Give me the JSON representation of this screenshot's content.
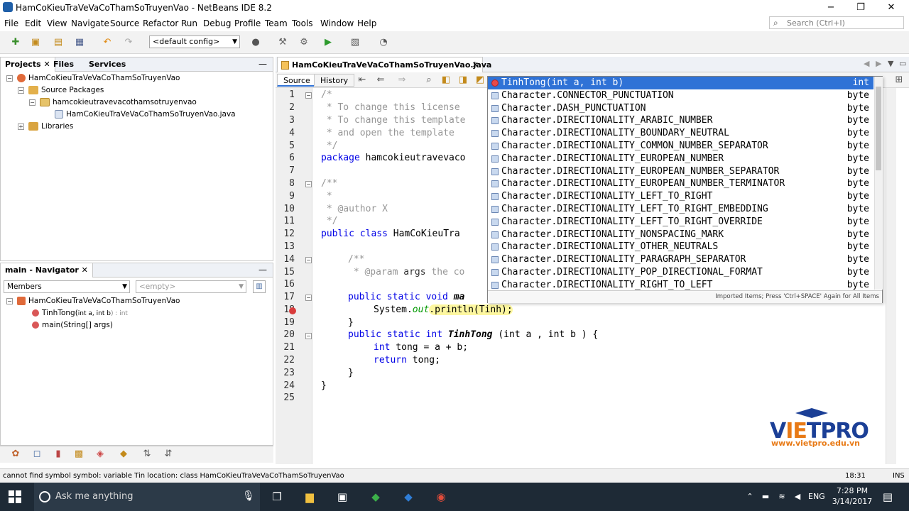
{
  "window": {
    "title": "HamCoKieuTraVeVaCoThamSoTruyenVao - NetBeans IDE 8.2",
    "minimize": "−",
    "restore": "❐",
    "close": "✕"
  },
  "menu": [
    "File",
    "Edit",
    "View",
    "Navigate",
    "Source",
    "Refactor",
    "Run",
    "Debug",
    "Profile",
    "Team",
    "Tools",
    "Window",
    "Help"
  ],
  "search": {
    "placeholder": "Search (Ctrl+I)"
  },
  "toolbar": {
    "config": "<default config>"
  },
  "projects_panel": {
    "tabs": [
      "Projects",
      "Files",
      "Services"
    ],
    "tree": [
      {
        "label": "HamCoKieuTraVeVaCoThamSoTruyenVao",
        "level": 0,
        "icon": "project-icon"
      },
      {
        "label": "Source Packages",
        "level": 1,
        "icon": "folder-icon"
      },
      {
        "label": "hamcokieutravevacothamsotruyenvao",
        "level": 2,
        "icon": "package-icon"
      },
      {
        "label": "HamCoKieuTraVeVaCoThamSoTruyenVao.java",
        "level": 3,
        "icon": "java-file-icon"
      },
      {
        "label": "Libraries",
        "level": 1,
        "icon": "library-icon"
      }
    ]
  },
  "navigator_panel": {
    "title": "main - Navigator",
    "members_combo": "Members",
    "empty_combo": "<empty>",
    "root": "HamCoKieuTraVeVaCoThamSoTruyenVao",
    "items": [
      {
        "name": "TinhTong(",
        "params": "int a, int b",
        "ret": ") : int"
      },
      {
        "name": "main(String[] args)",
        "params": "",
        "ret": ""
      }
    ]
  },
  "editor": {
    "file_tab": "HamCoKieuTraVeVaCoThamSoTruyenVao.java",
    "source_tab": "Source",
    "history_tab": "History",
    "line_numbers": [
      "1",
      "2",
      "3",
      "4",
      "5",
      "6",
      "7",
      "8",
      "9",
      "10",
      "11",
      "12",
      "13",
      "14",
      "15",
      "16",
      "17",
      "18",
      "19",
      "20",
      "21",
      "22",
      "23",
      "24",
      "25"
    ],
    "lines": {
      "l1": "/*",
      "l2": " * To change this license",
      "l3": " * To change this template",
      "l4": " * and open the template",
      "l5": " */",
      "l6a": "package",
      "l6b": " hamcokieutravevaco",
      "l8": "/**",
      "l9": " *",
      "l10": " * @author X",
      "l11": " */",
      "l12a": "public class",
      "l12b": " HamCoKieuTra",
      "l14": "/**",
      "l15a": " * @param",
      "l15b": " args",
      "l15c": " the co",
      "l17a": "public static void",
      "l17b": " ma",
      "l18a": "System.",
      "l18b": "out",
      "l18c": ".println(Tinh);",
      "l19": "}",
      "l20a": "public static int",
      "l20b": " TinhTong",
      "l20c": " (int a , int b ) {",
      "l21a": "int",
      "l21b": " tong = a + b;",
      "l22a": "return",
      "l22b": " tong;",
      "l23": "}",
      "l24": "}"
    }
  },
  "completion": {
    "items": [
      {
        "text": "TinhTong(int a, int b)",
        "type": "int"
      },
      {
        "text": "Character.CONNECTOR_PUNCTUATION",
        "type": "byte"
      },
      {
        "text": "Character.DASH_PUNCTUATION",
        "type": "byte"
      },
      {
        "text": "Character.DIRECTIONALITY_ARABIC_NUMBER",
        "type": "byte"
      },
      {
        "text": "Character.DIRECTIONALITY_BOUNDARY_NEUTRAL",
        "type": "byte"
      },
      {
        "text": "Character.DIRECTIONALITY_COMMON_NUMBER_SEPARATOR",
        "type": "byte"
      },
      {
        "text": "Character.DIRECTIONALITY_EUROPEAN_NUMBER",
        "type": "byte"
      },
      {
        "text": "Character.DIRECTIONALITY_EUROPEAN_NUMBER_SEPARATOR",
        "type": "byte"
      },
      {
        "text": "Character.DIRECTIONALITY_EUROPEAN_NUMBER_TERMINATOR",
        "type": "byte"
      },
      {
        "text": "Character.DIRECTIONALITY_LEFT_TO_RIGHT",
        "type": "byte"
      },
      {
        "text": "Character.DIRECTIONALITY_LEFT_TO_RIGHT_EMBEDDING",
        "type": "byte"
      },
      {
        "text": "Character.DIRECTIONALITY_LEFT_TO_RIGHT_OVERRIDE",
        "type": "byte"
      },
      {
        "text": "Character.DIRECTIONALITY_NONSPACING_MARK",
        "type": "byte"
      },
      {
        "text": "Character.DIRECTIONALITY_OTHER_NEUTRALS",
        "type": "byte"
      },
      {
        "text": "Character.DIRECTIONALITY_PARAGRAPH_SEPARATOR",
        "type": "byte"
      },
      {
        "text": "Character.DIRECTIONALITY_POP_DIRECTIONAL_FORMAT",
        "type": "byte"
      },
      {
        "text": "Character.DIRECTIONALITY_RIGHT_TO_LEFT",
        "type": "byte"
      }
    ],
    "footer": "Imported Items; Press 'Ctrl+SPACE' Again for All Items"
  },
  "watermark": {
    "brand_a": "V",
    "brand_b": "IE",
    "brand_c": "TPRO",
    "url": "www.vietpro.edu.vn"
  },
  "status": {
    "message": "cannot find symbol   symbol:  variable Tin   location: class HamCoKieuTraVeVaCoThamSoTruyenVao",
    "position": "18:31",
    "mode": "INS"
  },
  "taskbar": {
    "search_placeholder": "Ask me anything",
    "language": "ENG",
    "time": "7:28 PM",
    "date": "3/14/2017"
  },
  "colors": {
    "selection": "#2f72d6",
    "keyword": "#0000e6",
    "comment": "#969696",
    "field": "#009900"
  }
}
